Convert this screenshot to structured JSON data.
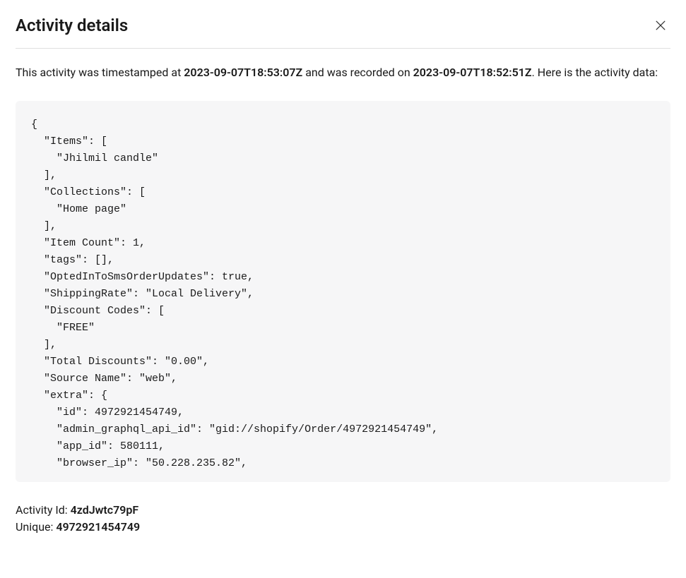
{
  "header": {
    "title": "Activity details"
  },
  "description": {
    "prefix": "This activity was timestamped at ",
    "timestamp": "2023-09-07T18:53:07Z",
    "mid": " and was recorded on ",
    "recorded": "2023-09-07T18:52:51Z",
    "suffix": ". Here is the activity data:"
  },
  "code": "{\n  \"Items\": [\n    \"Jhilmil candle\"\n  ],\n  \"Collections\": [\n    \"Home page\"\n  ],\n  \"Item Count\": 1,\n  \"tags\": [],\n  \"OptedInToSmsOrderUpdates\": true,\n  \"ShippingRate\": \"Local Delivery\",\n  \"Discount Codes\": [\n    \"FREE\"\n  ],\n  \"Total Discounts\": \"0.00\",\n  \"Source Name\": \"web\",\n  \"extra\": {\n    \"id\": 4972921454749,\n    \"admin_graphql_api_id\": \"gid://shopify/Order/4972921454749\",\n    \"app_id\": 580111,\n    \"browser_ip\": \"50.228.235.82\",",
  "footer": {
    "activity_id_label": "Activity Id: ",
    "activity_id_value": "4zdJwtc79pF",
    "unique_label": "Unique: ",
    "unique_value": "4972921454749"
  }
}
